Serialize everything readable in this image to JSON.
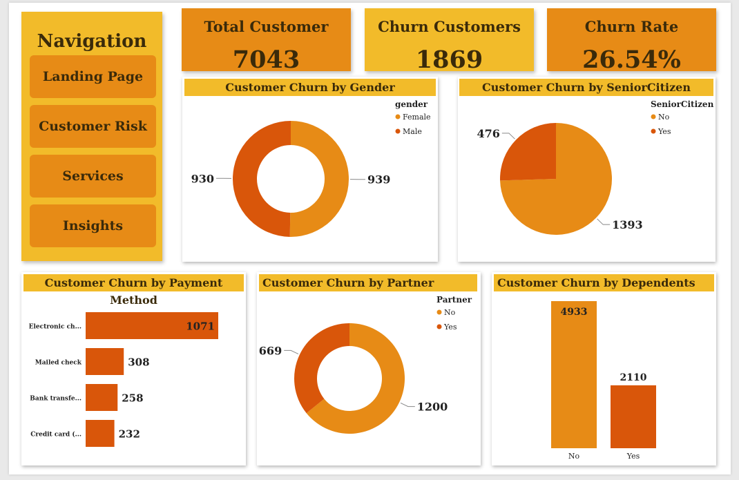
{
  "navigation": {
    "title": "Navigation",
    "buttons": [
      "Landing Page",
      "Customer Risk",
      "Services",
      "Insights"
    ]
  },
  "kpis": {
    "total": {
      "label": "Total Customer",
      "value": "7043"
    },
    "churn": {
      "label": "Churn Customers",
      "value": "1869"
    },
    "rate": {
      "label": "Churn Rate",
      "value": "26.54%"
    }
  },
  "colors": {
    "orange": "#e78b16",
    "dark_orange": "#d9560a",
    "yellow": "#f2bb2a"
  },
  "chart_data": [
    {
      "type": "pie",
      "donut": true,
      "title": "Customer Churn by Gender",
      "legend_title": "gender",
      "legend_position": "top-right",
      "labels": [
        "Female",
        "Male"
      ],
      "values": [
        939,
        930
      ],
      "colors": [
        "#e78b16",
        "#d9560a"
      ]
    },
    {
      "type": "pie",
      "donut": false,
      "title": "Customer Churn by SeniorCitizen",
      "legend_title": "SeniorCitizen",
      "legend_position": "top-right",
      "labels": [
        "No",
        "Yes"
      ],
      "values": [
        1393,
        476
      ],
      "colors": [
        "#e78b16",
        "#d9560a"
      ]
    },
    {
      "type": "bar",
      "orientation": "horizontal",
      "title": "Customer Churn by Payment Method",
      "categories": [
        "Electronic ch...",
        "Mailed check",
        "Bank transfe...",
        "Credit card (..."
      ],
      "values": [
        1071,
        308,
        258,
        232
      ],
      "color": "#d9560a"
    },
    {
      "type": "pie",
      "donut": true,
      "title": "Customer Churn by Partner",
      "legend_title": "Partner",
      "legend_position": "top-right",
      "labels": [
        "No",
        "Yes"
      ],
      "values": [
        1200,
        669
      ],
      "colors": [
        "#e78b16",
        "#d9560a"
      ]
    },
    {
      "type": "bar",
      "orientation": "vertical",
      "title": "Customer Churn by Dependents",
      "categories": [
        "No",
        "Yes"
      ],
      "values": [
        4933,
        2110
      ],
      "colors": [
        "#e78b16",
        "#d9560a"
      ]
    }
  ]
}
